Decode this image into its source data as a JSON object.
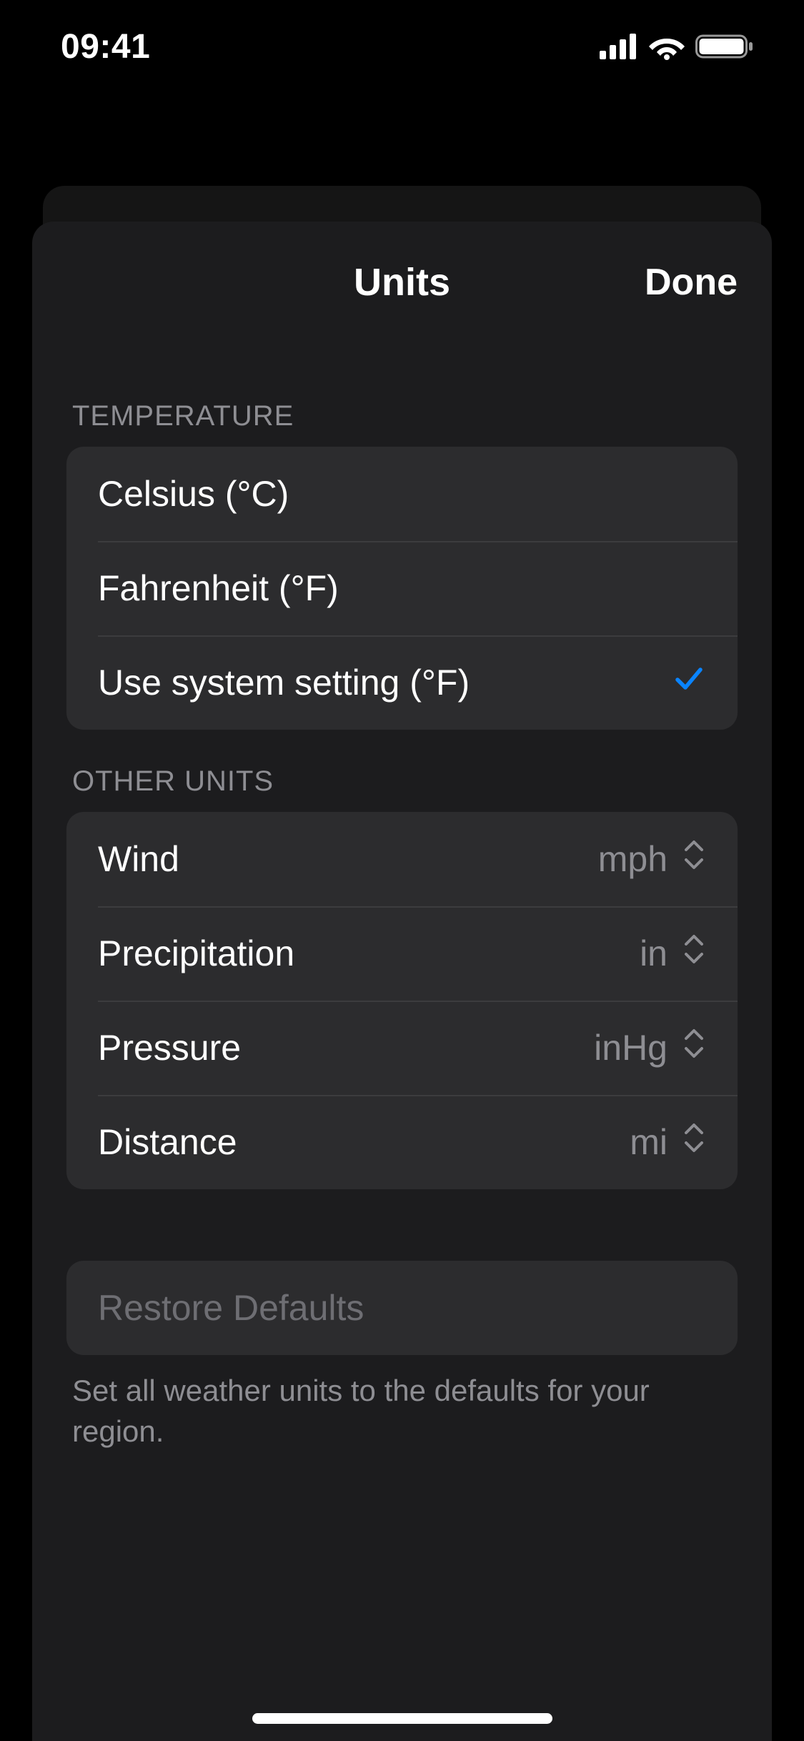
{
  "status": {
    "time": "09:41"
  },
  "sheet": {
    "title": "Units",
    "done": "Done"
  },
  "temperature": {
    "header": "TEMPERATURE",
    "options": [
      {
        "label": "Celsius (°C)",
        "selected": false
      },
      {
        "label": "Fahrenheit (°F)",
        "selected": false
      },
      {
        "label": "Use system setting (°F)",
        "selected": true
      }
    ]
  },
  "other_units": {
    "header": "OTHER UNITS",
    "rows": [
      {
        "label": "Wind",
        "value": "mph"
      },
      {
        "label": "Precipitation",
        "value": "in"
      },
      {
        "label": "Pressure",
        "value": "inHg"
      },
      {
        "label": "Distance",
        "value": "mi"
      }
    ]
  },
  "restore": {
    "button": "Restore Defaults",
    "footer": "Set all weather units to the defaults for your region."
  }
}
